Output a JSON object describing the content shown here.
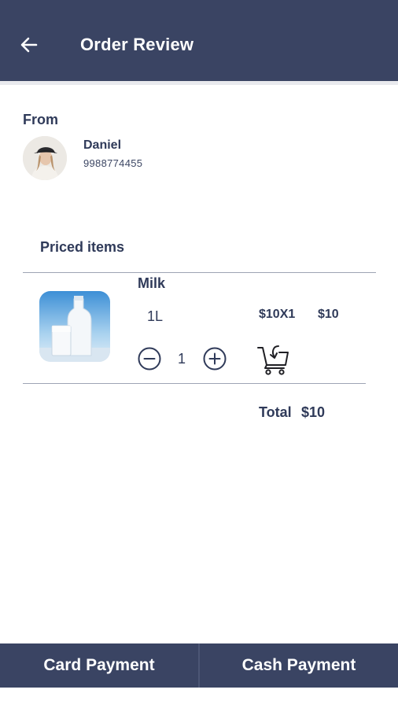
{
  "header": {
    "title": "Order Review",
    "back_icon": "arrow-left-icon"
  },
  "from": {
    "label": "From",
    "name": "Daniel",
    "phone": "9988774455"
  },
  "priced_items": {
    "title": "Priced items",
    "items": [
      {
        "name": "Milk",
        "size": "1L",
        "quantity": "1",
        "unit_calc": "$10X1",
        "line_price": "$10",
        "image": "milk-glass-bottle"
      }
    ]
  },
  "summary": {
    "total_label": "Total",
    "total_value": "$10"
  },
  "footer": {
    "card_label": "Card Payment",
    "cash_label": "Cash Payment"
  },
  "colors": {
    "primary": "#3a4463",
    "text": "#2f3a59"
  }
}
